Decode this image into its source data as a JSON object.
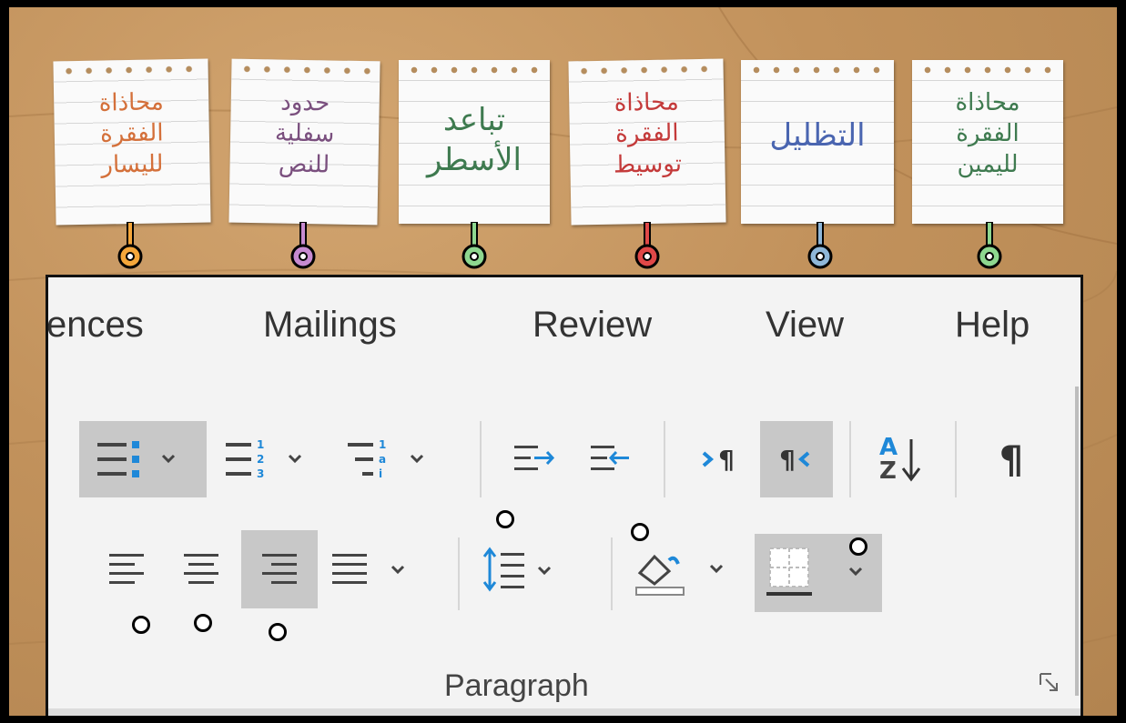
{
  "notes": [
    {
      "text": "محاذاة\nالفقرة\nلليسار",
      "color": "#d4703a",
      "pin_color": "#f4a63a"
    },
    {
      "text": "حدود\nسفلية\nللنص",
      "color": "#7a4f7e",
      "pin_color": "#c78ad0"
    },
    {
      "text": "تباعد\nالأسطر",
      "color": "#3e7a4f",
      "pin_color": "#8ed78f"
    },
    {
      "text": "محاذاة\nالفقرة\nتوسيط",
      "color": "#c43a3a",
      "pin_color": "#e04848"
    },
    {
      "text": "التظليل",
      "color": "#4a65b0",
      "pin_color": "#8fb7d8"
    },
    {
      "text": "محاذاة\nالفقرة\nلليمين",
      "color": "#3e7a4f",
      "pin_color": "#8ed78f"
    }
  ],
  "tabs": [
    "ences",
    "Mailings",
    "Review",
    "View",
    "Help"
  ],
  "toolbar": {
    "group_label": "Paragraph",
    "rtl_label": "¶",
    "ltr_label": "¶",
    "show_marks_label": "¶",
    "sort_a": "A",
    "sort_z": "Z"
  },
  "icons": {
    "bullets": "bullets-icon",
    "numbering": "numbering-icon",
    "multilevel": "multilevel-list-icon",
    "decrease_indent": "decrease-indent-icon",
    "increase_indent": "increase-indent-icon",
    "ltr": "left-to-right-icon",
    "rtl": "right-to-left-icon",
    "sort": "sort-icon",
    "show_marks": "show-hide-marks-icon",
    "align_left": "align-left-icon",
    "center": "center-icon",
    "align_right": "align-right-icon",
    "justify": "justify-icon",
    "line_spacing": "line-spacing-icon",
    "shading": "shading-icon",
    "borders": "borders-icon"
  },
  "colors": {
    "accent_blue": "#1e88d8",
    "selected_bg": "#c8c8c8"
  }
}
